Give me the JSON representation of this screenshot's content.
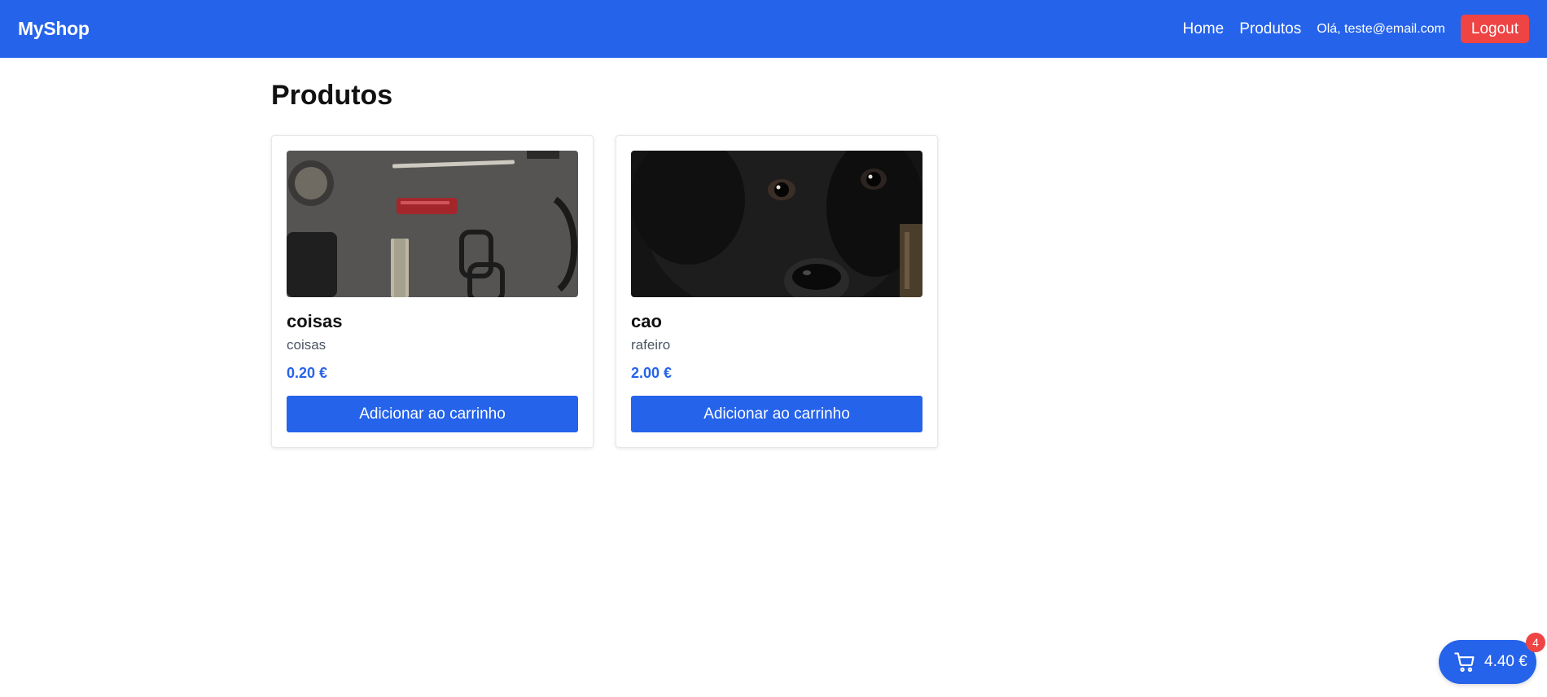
{
  "nav": {
    "brand": "MyShop",
    "links": [
      "Home",
      "Produtos"
    ],
    "greeting": "Olá, teste@email.com",
    "logout_label": "Logout"
  },
  "page": {
    "title": "Produtos"
  },
  "products": [
    {
      "name": "coisas",
      "description": "coisas",
      "price": "0.20 €",
      "button_label": "Adicionar ao carrinho"
    },
    {
      "name": "cao",
      "description": "rafeiro",
      "price": "2.00 €",
      "button_label": "Adicionar ao carrinho"
    }
  ],
  "cart": {
    "total": "4.40 €",
    "count": "4",
    "icon": "shopping-cart-icon"
  },
  "colors": {
    "primary": "#2563eb",
    "danger": "#ef4444"
  }
}
